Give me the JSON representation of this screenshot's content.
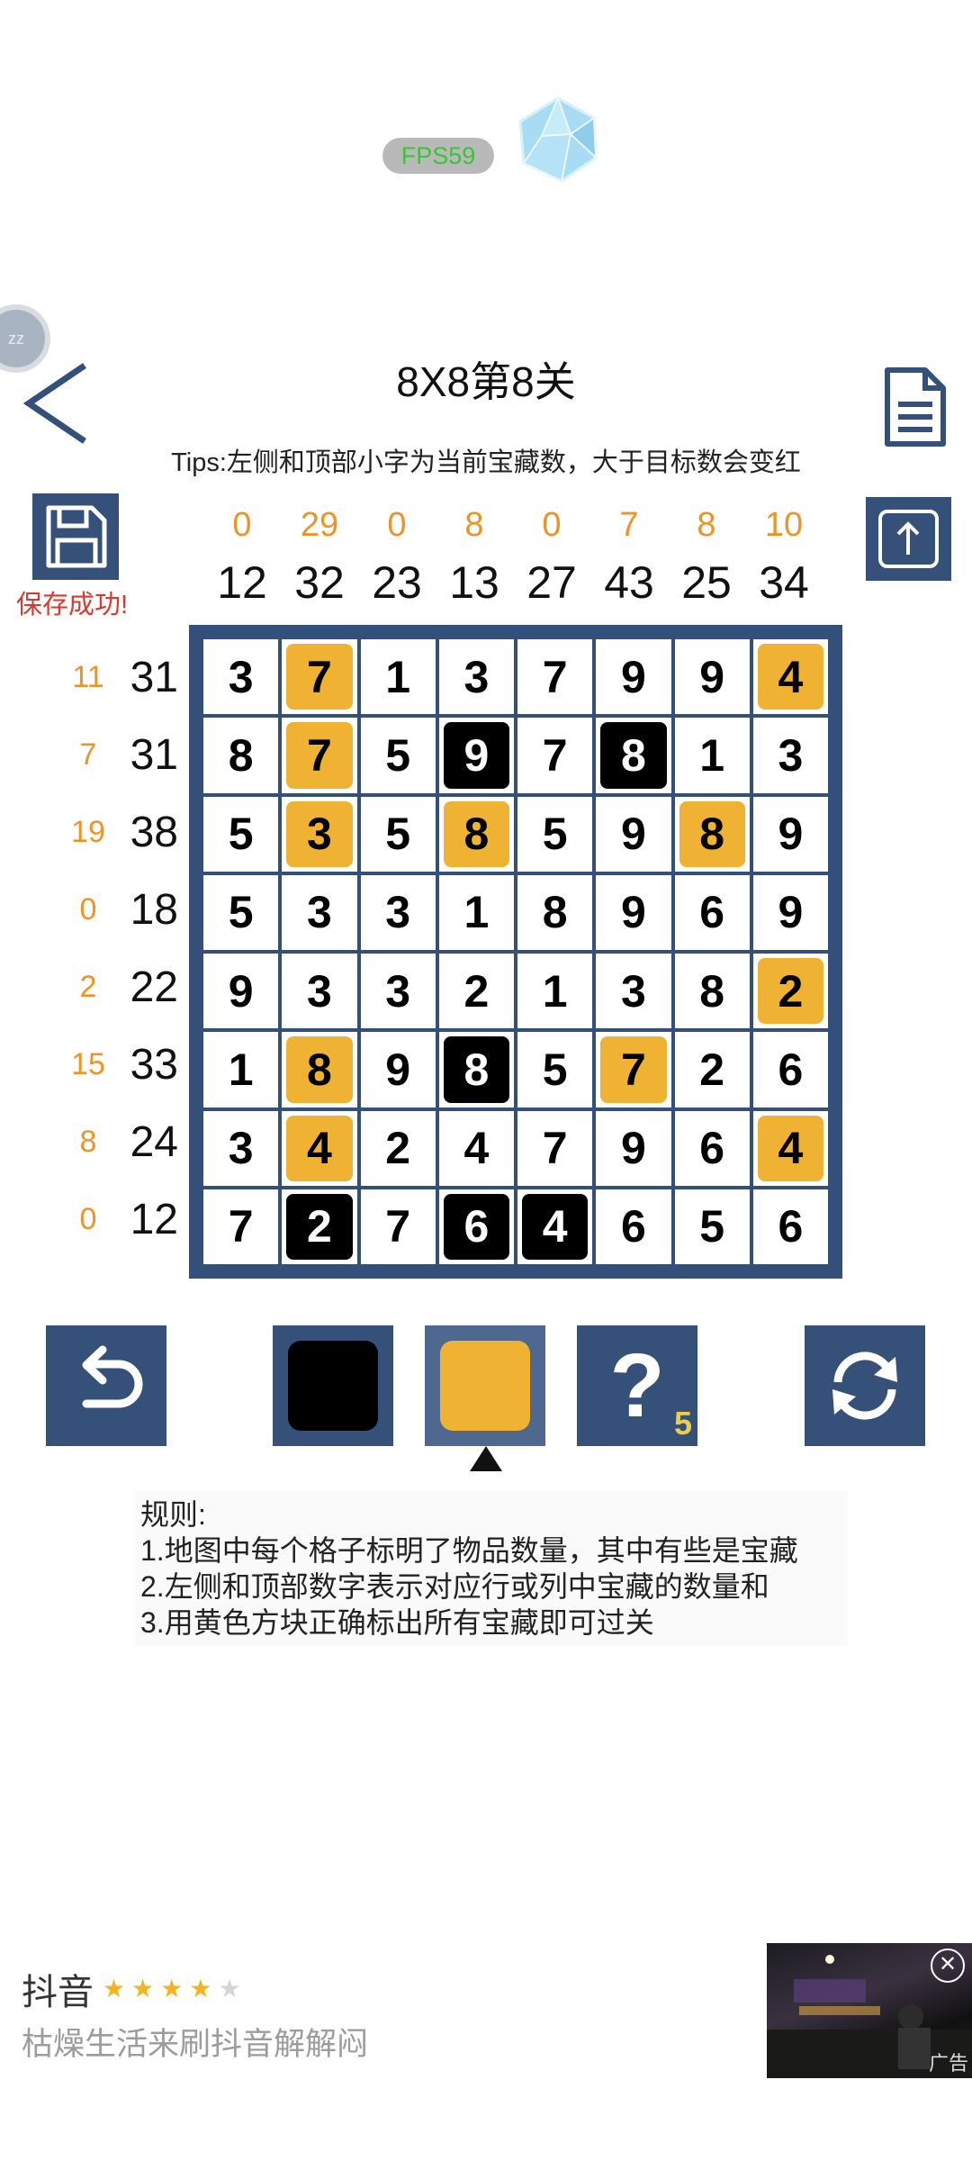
{
  "debug": {
    "fps": "FPS59",
    "bubble": "zz"
  },
  "header": {
    "title": "8X8第8关",
    "tips": "Tips:左侧和顶部小字为当前宝藏数，大于目标数会变红"
  },
  "save": {
    "message": "保存成功!"
  },
  "columns": {
    "current": [
      "0",
      "29",
      "0",
      "8",
      "0",
      "7",
      "8",
      "10"
    ],
    "target": [
      "12",
      "32",
      "23",
      "13",
      "27",
      "43",
      "25",
      "34"
    ]
  },
  "rows": {
    "current": [
      "11",
      "7",
      "19",
      "0",
      "2",
      "15",
      "8",
      "0"
    ],
    "target": [
      "31",
      "31",
      "38",
      "18",
      "22",
      "33",
      "24",
      "12"
    ]
  },
  "board": {
    "colors": {
      "frame": "#33507a",
      "treasure": "#efb233",
      "blocked": "#000000"
    },
    "cells": [
      [
        [
          "3",
          ""
        ],
        [
          "7",
          "y"
        ],
        [
          "1",
          ""
        ],
        [
          "3",
          ""
        ],
        [
          "7",
          ""
        ],
        [
          "9",
          ""
        ],
        [
          "9",
          ""
        ],
        [
          "4",
          "y"
        ]
      ],
      [
        [
          "8",
          ""
        ],
        [
          "7",
          "y"
        ],
        [
          "5",
          ""
        ],
        [
          "9",
          "b"
        ],
        [
          "7",
          ""
        ],
        [
          "8",
          "b"
        ],
        [
          "1",
          ""
        ],
        [
          "3",
          ""
        ]
      ],
      [
        [
          "5",
          ""
        ],
        [
          "3",
          "y"
        ],
        [
          "5",
          ""
        ],
        [
          "8",
          "y"
        ],
        [
          "5",
          ""
        ],
        [
          "9",
          ""
        ],
        [
          "8",
          "y"
        ],
        [
          "9",
          ""
        ]
      ],
      [
        [
          "5",
          ""
        ],
        [
          "3",
          ""
        ],
        [
          "3",
          ""
        ],
        [
          "1",
          ""
        ],
        [
          "8",
          ""
        ],
        [
          "9",
          ""
        ],
        [
          "6",
          ""
        ],
        [
          "9",
          ""
        ]
      ],
      [
        [
          "9",
          ""
        ],
        [
          "3",
          ""
        ],
        [
          "3",
          ""
        ],
        [
          "2",
          ""
        ],
        [
          "1",
          ""
        ],
        [
          "3",
          ""
        ],
        [
          "8",
          ""
        ],
        [
          "2",
          "y"
        ]
      ],
      [
        [
          "1",
          ""
        ],
        [
          "8",
          "y"
        ],
        [
          "9",
          ""
        ],
        [
          "8",
          "b"
        ],
        [
          "5",
          ""
        ],
        [
          "7",
          "y"
        ],
        [
          "2",
          ""
        ],
        [
          "6",
          ""
        ]
      ],
      [
        [
          "3",
          ""
        ],
        [
          "4",
          "y"
        ],
        [
          "2",
          ""
        ],
        [
          "4",
          ""
        ],
        [
          "7",
          ""
        ],
        [
          "9",
          ""
        ],
        [
          "6",
          ""
        ],
        [
          "4",
          "y"
        ]
      ],
      [
        [
          "7",
          ""
        ],
        [
          "2",
          "b"
        ],
        [
          "7",
          ""
        ],
        [
          "6",
          "b"
        ],
        [
          "4",
          "b"
        ],
        [
          "6",
          ""
        ],
        [
          "5",
          ""
        ],
        [
          "6",
          ""
        ]
      ]
    ]
  },
  "tools": {
    "hint_symbol": "?",
    "hint_count": "5",
    "selected": "yellow"
  },
  "rules": {
    "heading": "规则:",
    "items": [
      "1.地图中每个格子标明了物品数量，其中有些是宝藏",
      "2.左侧和顶部数字表示对应行或列中宝藏的数量和",
      "3.用黄色方块正确标出所有宝藏即可过关"
    ]
  },
  "ad": {
    "title": "抖音",
    "rating_stars": 4,
    "subtitle": "枯燥生活来刷抖音解解闷",
    "close": "✕",
    "tag": "广告"
  }
}
